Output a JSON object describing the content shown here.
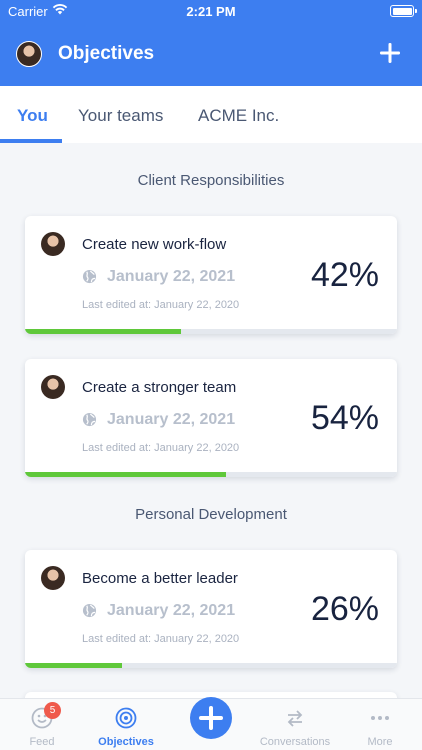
{
  "status_bar": {
    "carrier": "Carrier",
    "time": "2:21 PM"
  },
  "header": {
    "title": "Objectives"
  },
  "tabs": [
    {
      "label": "You",
      "active": true
    },
    {
      "label": "Your teams",
      "active": false
    },
    {
      "label": "ACME Inc.",
      "active": false
    }
  ],
  "sections": [
    {
      "title": "Client Responsibilities",
      "objectives": [
        {
          "title": "Create new work-flow",
          "date": "January 22, 2021",
          "edited": "Last edited at: January 22, 2020",
          "percent": "42%",
          "progress": 0.42
        },
        {
          "title": "Create a stronger team",
          "date": "January 22, 2021",
          "edited": "Last edited at: January 22, 2020",
          "percent": "54%",
          "progress": 0.54
        }
      ]
    },
    {
      "title": "Personal Development",
      "objectives": [
        {
          "title": "Become a better leader",
          "date": "January 22, 2021",
          "edited": "Last edited at: January 22, 2020",
          "percent": "26%",
          "progress": 0.26
        }
      ]
    }
  ],
  "tabbar": {
    "items": [
      {
        "label": "Feed",
        "icon": "smiley-icon",
        "badge": "5"
      },
      {
        "label": "Objectives",
        "icon": "target-icon",
        "active": true
      },
      {
        "label": "",
        "icon": "plus-icon"
      },
      {
        "label": "Conversations",
        "icon": "swap-arrows-icon"
      },
      {
        "label": "More",
        "icon": "ellipsis-icon"
      }
    ]
  },
  "colors": {
    "primary": "#3d7ef0",
    "progress": "#5fc83a",
    "badge": "#ef5a4c"
  }
}
